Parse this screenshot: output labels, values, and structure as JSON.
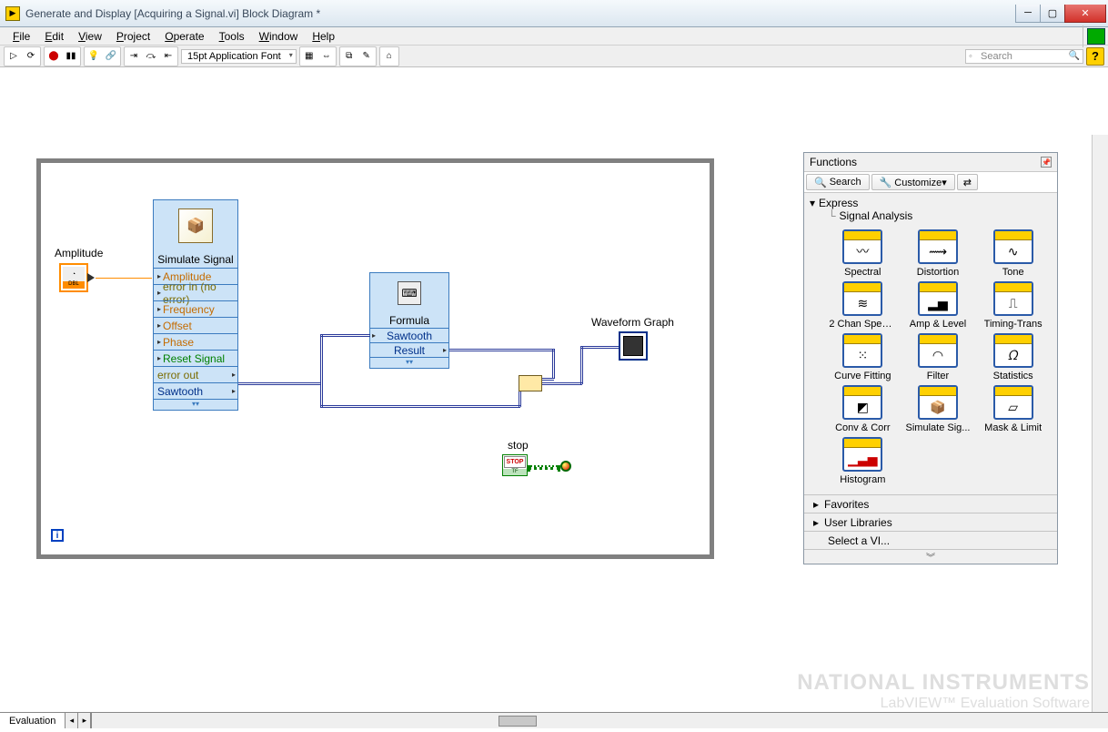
{
  "title": "Generate and Display [Acquiring a Signal.vi] Block Diagram *",
  "menu": {
    "file": "File",
    "edit": "Edit",
    "view": "View",
    "project": "Project",
    "operate": "Operate",
    "tools": "Tools",
    "window": "Window",
    "help": "Help"
  },
  "toolbar": {
    "font": "15pt Application Font",
    "search_placeholder": "Search",
    "help": "?"
  },
  "diagram": {
    "amplitude_label": "Amplitude",
    "amplitude_fmt": "DBL",
    "simulate": {
      "title": "Simulate Signal",
      "rows": [
        "Amplitude",
        "error in (no error)",
        "Frequency",
        "Offset",
        "Phase",
        "Reset Signal",
        "error out",
        "Sawtooth"
      ]
    },
    "formula": {
      "title": "Formula",
      "input": "Sawtooth",
      "output": "Result"
    },
    "waveform_label": "Waveform Graph",
    "stop_label": "stop",
    "stop_text": "STOP",
    "stop_fmt": "TF",
    "info": "i"
  },
  "palette": {
    "title": "Functions",
    "search": "Search",
    "customize": "Customize▾",
    "express": "Express",
    "signal_analysis": "Signal Analysis",
    "items": [
      "Spectral",
      "Distortion",
      "Tone",
      "2 Chan Spect...",
      "Amp & Level",
      "Timing-Trans",
      "Curve Fitting",
      "Filter",
      "Statistics",
      "Conv & Corr",
      "Simulate Sig...",
      "Mask & Limit",
      "Histogram"
    ],
    "favorites": "Favorites",
    "user_libs": "User Libraries",
    "select_vi": "Select a VI...",
    "more": "︾"
  },
  "tab": "Evaluation",
  "watermark": {
    "ni": "NATIONAL INSTRUMENTS",
    "lv": "LabVIEW™ Evaluation Software"
  }
}
